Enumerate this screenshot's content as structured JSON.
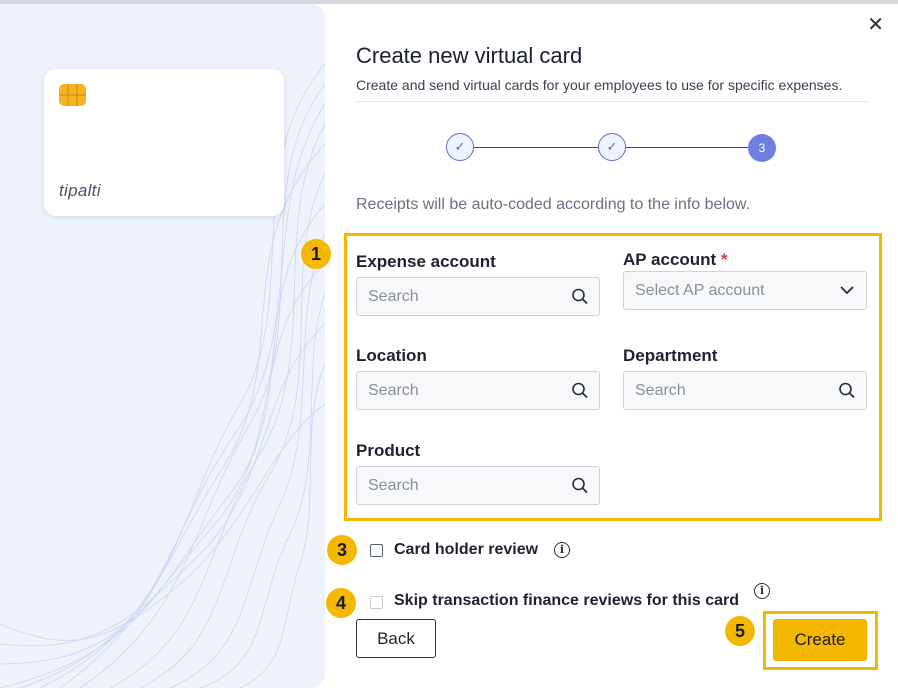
{
  "dialog": {
    "title": "Create new virtual card",
    "subtitle": "Create and send virtual cards for your employees to use for specific expenses.",
    "close_symbol": "✕"
  },
  "card_preview": {
    "logo_text": "tipalti",
    "chip_icon": "chip-icon"
  },
  "stepper": {
    "steps": [
      {
        "state": "complete",
        "glyph": "✓"
      },
      {
        "state": "complete",
        "glyph": "✓"
      },
      {
        "state": "current",
        "label": "3"
      }
    ]
  },
  "intro_text": "Receipts will be auto-coded according to the info below.",
  "badges": [
    "1",
    "3",
    "4",
    "5"
  ],
  "fields": {
    "expense_account": {
      "label": "Expense account",
      "placeholder": "Search"
    },
    "ap_account": {
      "label": "AP account",
      "required_mark": "*",
      "placeholder": "Select AP account"
    },
    "location": {
      "label": "Location",
      "placeholder": "Search"
    },
    "department": {
      "label": "Department",
      "placeholder": "Search"
    },
    "product": {
      "label": "Product",
      "placeholder": "Search"
    }
  },
  "options": {
    "card_holder_review": {
      "label": "Card holder review",
      "checked": false
    },
    "skip_finance_reviews": {
      "label": "Skip transaction finance reviews for this card",
      "checked": false
    }
  },
  "buttons": {
    "back": "Back",
    "create": "Create"
  },
  "colors": {
    "accent_yellow": "#f5b800",
    "stepper_blue": "#6f7fe0",
    "left_panel": "#eef2fb",
    "required_red": "#e0354a"
  }
}
